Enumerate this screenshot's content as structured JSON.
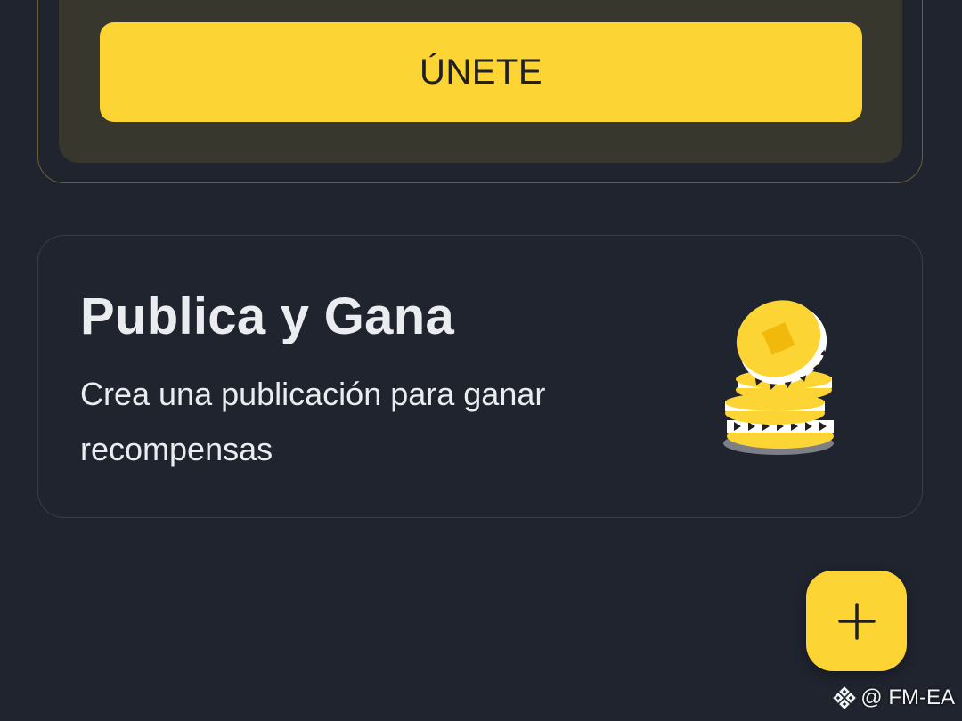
{
  "promo": {
    "join_label": "ÚNETE"
  },
  "earn": {
    "title": "Publica y Gana",
    "description": "Crea una publicación para ganar recompensas",
    "icon": "gold-coins-icon"
  },
  "fab": {
    "icon": "plus-icon"
  },
  "watermark": {
    "text": "@ FM-EA",
    "icon": "binance-logo-icon"
  },
  "colors": {
    "background": "#20242f",
    "accent": "#fcd535",
    "promo_inner": "#37372e",
    "promo_border": "#6b5f35",
    "card_border": "#383d49",
    "text": "#eaecef"
  }
}
